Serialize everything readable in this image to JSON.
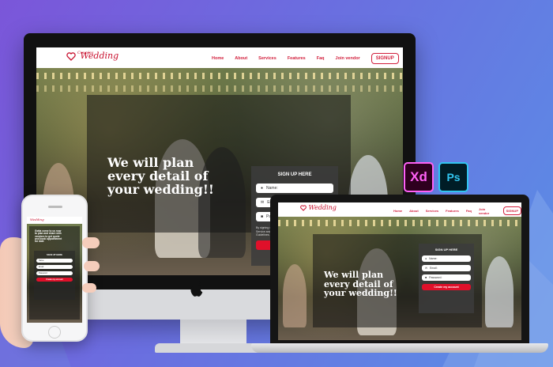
{
  "site": {
    "logo_line1": "Couples",
    "logo_line2": "Wedding",
    "nav": [
      "Home",
      "About",
      "Services",
      "Features",
      "Faq",
      "Join vendor"
    ],
    "signup_button": "SIGNUP",
    "headline": "We will plan\nevery detail of\nyour wedding!!",
    "mobile_headline": "Gotta come to us now\nto plan and share with\nvendors to get quote\nand book appointment\nfor date",
    "form": {
      "title": "SIGN UP HERE",
      "name_placeholder": "Name:",
      "email_placeholder": "Email:",
      "password_placeholder": "Password:",
      "terms": "By signing up, I agree to Couples Wedding Hub Terms of Service and Privacy Policy. I also agree the Community Guidelines.",
      "cta": "Create my account"
    }
  },
  "badges": {
    "xd": "Xd",
    "ps": "Ps"
  },
  "colors": {
    "brand_red": "#d21f3c",
    "background_start": "#7b56d9",
    "background_end": "#5a8fe6"
  }
}
